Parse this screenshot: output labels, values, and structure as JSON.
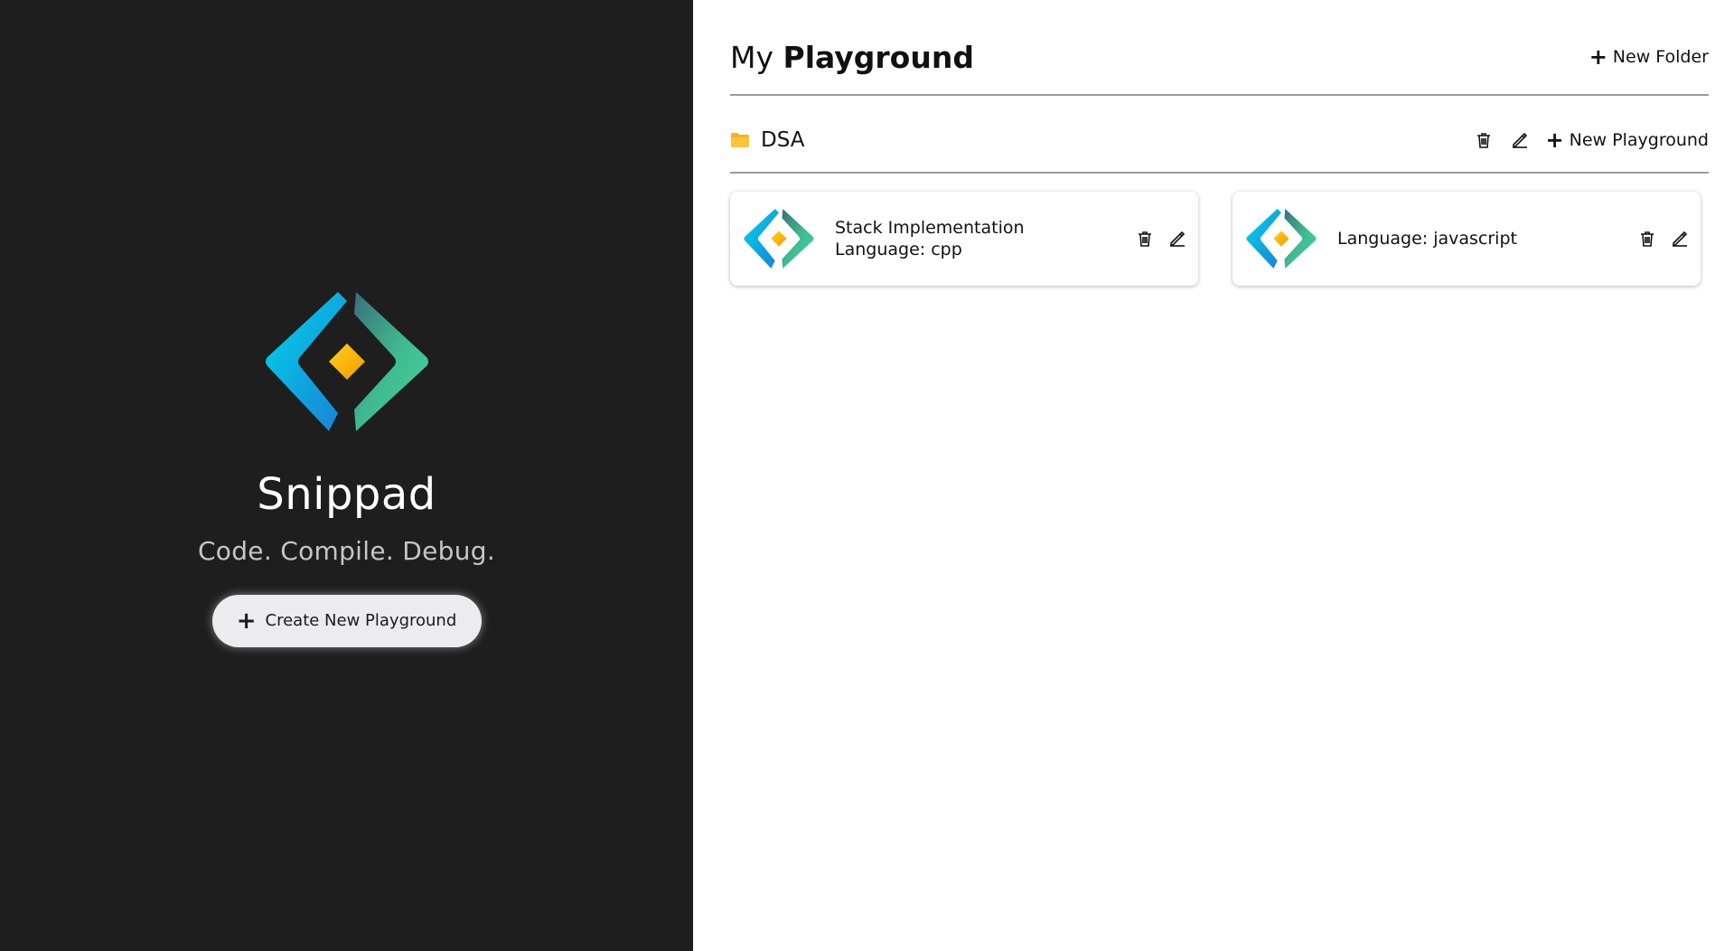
{
  "app": {
    "name": "Snippad",
    "tagline": "Code. Compile. Debug.",
    "create_button_label": "Create New Playground"
  },
  "header": {
    "title_prefix": "My",
    "title_bold": "Playground",
    "new_folder_label": "New Folder"
  },
  "folders": [
    {
      "name": "DSA",
      "new_playground_label": "New Playground",
      "cards": [
        {
          "title": "Stack Implementation",
          "language": "Language: cpp"
        },
        {
          "title": "",
          "language": "Language: javascript"
        }
      ]
    }
  ],
  "colors": {
    "left_panel_bg": "#1e1e1e",
    "folder_icon": "#f5b21b",
    "logo_cyan": "#00c8e0",
    "logo_green": "#3ec99a",
    "logo_diamond": "#f9b400"
  },
  "icons": [
    "plus-icon",
    "folder-icon",
    "trash-icon",
    "pencil-icon",
    "snippad-logo"
  ]
}
